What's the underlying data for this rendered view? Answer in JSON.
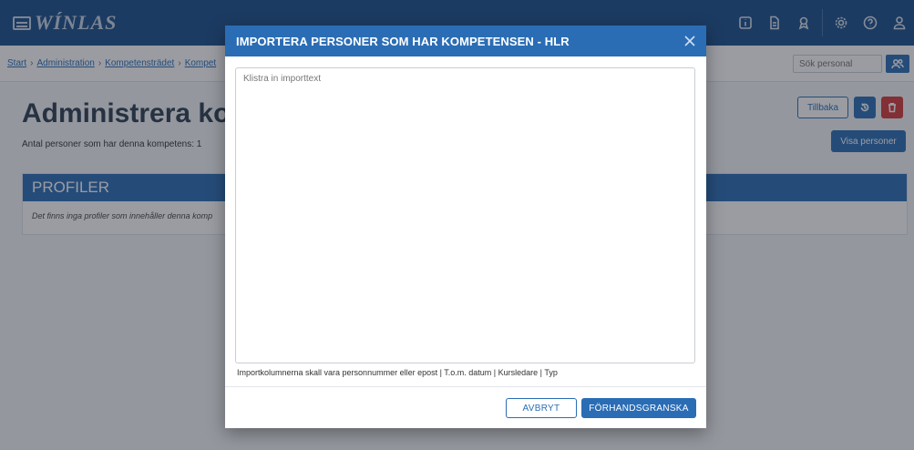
{
  "app": {
    "logo_text": "WÍNLAS"
  },
  "topbar": {
    "icons": [
      "info-icon",
      "document-icon",
      "users-badge-icon",
      "settings-icon",
      "help-icon",
      "user-icon"
    ]
  },
  "breadcrumb": {
    "items": [
      "Start",
      "Administration",
      "Kompetensträdet",
      "Kompet"
    ]
  },
  "search": {
    "placeholder": "Sök personal"
  },
  "page": {
    "title": "Administrera komp",
    "count_text": "Antal personer som har denna kompetens: 1",
    "back_label": "Tillbaka",
    "show_people_label": "Visa personer"
  },
  "profiles": {
    "header": "PROFILER",
    "empty_text": "Det finns inga profiler som innehåller denna komp"
  },
  "modal": {
    "title": "IMPORTERA PERSONER SOM HAR KOMPETENSEN - HLR",
    "textarea_placeholder": "Klistra in importtext",
    "help_text": "Importkolumnerna skall vara personnummer eller epost | T.o.m. datum | Kursledare | Typ",
    "cancel_label": "AVBRYT",
    "preview_label": "FÖRHANDSGRANSKA"
  },
  "colors": {
    "brand": "#2a6db5",
    "topbar": "#1b4f8a",
    "danger": "#d33a3a"
  }
}
